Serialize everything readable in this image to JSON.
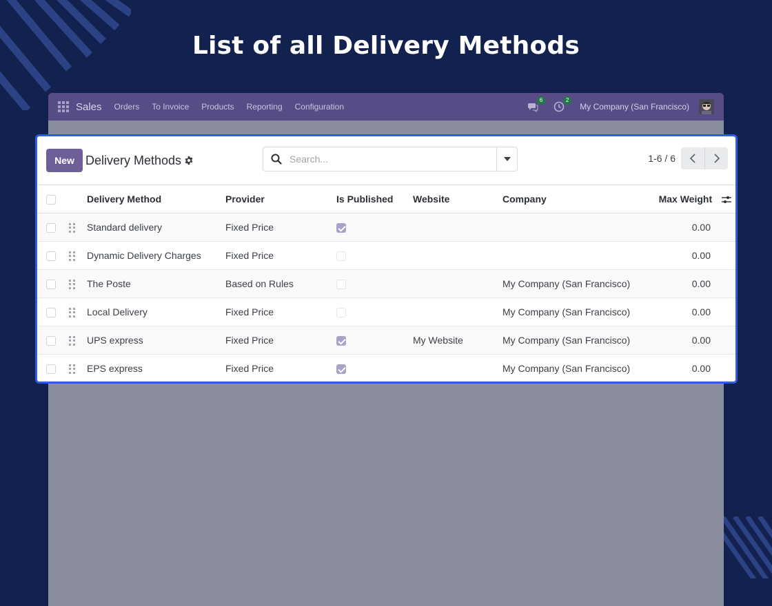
{
  "headline": "List of all Delivery Methods",
  "navbar": {
    "app_name": "Sales",
    "menu": [
      "Orders",
      "To Invoice",
      "Products",
      "Reporting",
      "Configuration"
    ],
    "messages_badge": "6",
    "activities_badge": "2",
    "company": "My Company (San Francisco)",
    "icons": [
      "apps-grid-icon",
      "chat-icon",
      "clock-icon",
      "user-avatar"
    ]
  },
  "control_panel": {
    "new_label": "New",
    "title": "Delivery Methods",
    "search_placeholder": "Search...",
    "pager": "1-6 / 6"
  },
  "table": {
    "columns": [
      "Delivery Method",
      "Provider",
      "Is Published",
      "Website",
      "Company",
      "Max Weight"
    ],
    "rows": [
      {
        "name": "Standard delivery",
        "provider": "Fixed Price",
        "published": true,
        "website": "",
        "company": "",
        "max_weight": "0.00"
      },
      {
        "name": "Dynamic Delivery Charges",
        "provider": "Fixed Price",
        "published": false,
        "website": "",
        "company": "",
        "max_weight": "0.00"
      },
      {
        "name": "The Poste",
        "provider": "Based on Rules",
        "published": false,
        "website": "",
        "company": "My Company (San Francisco)",
        "max_weight": "0.00"
      },
      {
        "name": "Local Delivery",
        "provider": "Fixed Price",
        "published": false,
        "website": "",
        "company": "My Company (San Francisco)",
        "max_weight": "0.00"
      },
      {
        "name": "UPS express",
        "provider": "Fixed Price",
        "published": true,
        "website": "My Website",
        "company": "My Company (San Francisco)",
        "max_weight": "0.00"
      },
      {
        "name": "EPS express",
        "provider": "Fixed Price",
        "published": true,
        "website": "",
        "company": "My Company (San Francisco)",
        "max_weight": "0.00"
      }
    ]
  },
  "colors": {
    "background": "#13214f",
    "navbar": "#574c86",
    "primary_button": "#6e5f99",
    "highlight_border": "#2f5be0"
  }
}
